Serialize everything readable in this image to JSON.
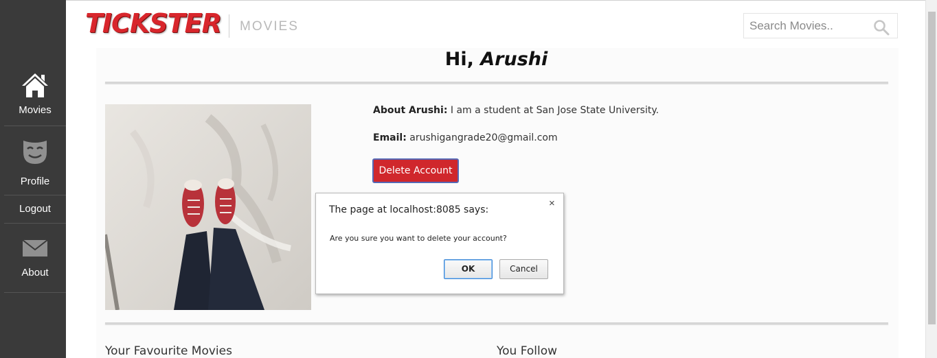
{
  "sidebar": {
    "items": [
      {
        "label": "Movies",
        "icon": "home-icon"
      },
      {
        "label": "Profile",
        "icon": "mask-icon"
      },
      {
        "label": "Logout"
      },
      {
        "label": "About",
        "icon": "envelope-icon"
      }
    ]
  },
  "header": {
    "logo_text": "TICKSTER",
    "section_title": "MOVIES",
    "search_placeholder": "Search Movies.."
  },
  "profile": {
    "greeting_prefix": "Hi,",
    "user_name": "Arushi",
    "about_label": "About Arushi:",
    "about_text": "I am a student at San Jose State University.",
    "email_label": "Email:",
    "email_value": "arushigangrade20@gmail.com",
    "delete_button": "Delete Account"
  },
  "sections": {
    "favourites_title": "Your Favourite Movies",
    "follow_title": "You Follow"
  },
  "dialog": {
    "title": "The page at localhost:8085 says:",
    "message": "Are you sure you want to delete your account?",
    "ok_label": "OK",
    "cancel_label": "Cancel",
    "close_glyph": "×"
  },
  "colors": {
    "sidebar_bg": "#3a3a3a",
    "brand_red": "#d8262c",
    "delete_button_bg": "#d0272c"
  }
}
